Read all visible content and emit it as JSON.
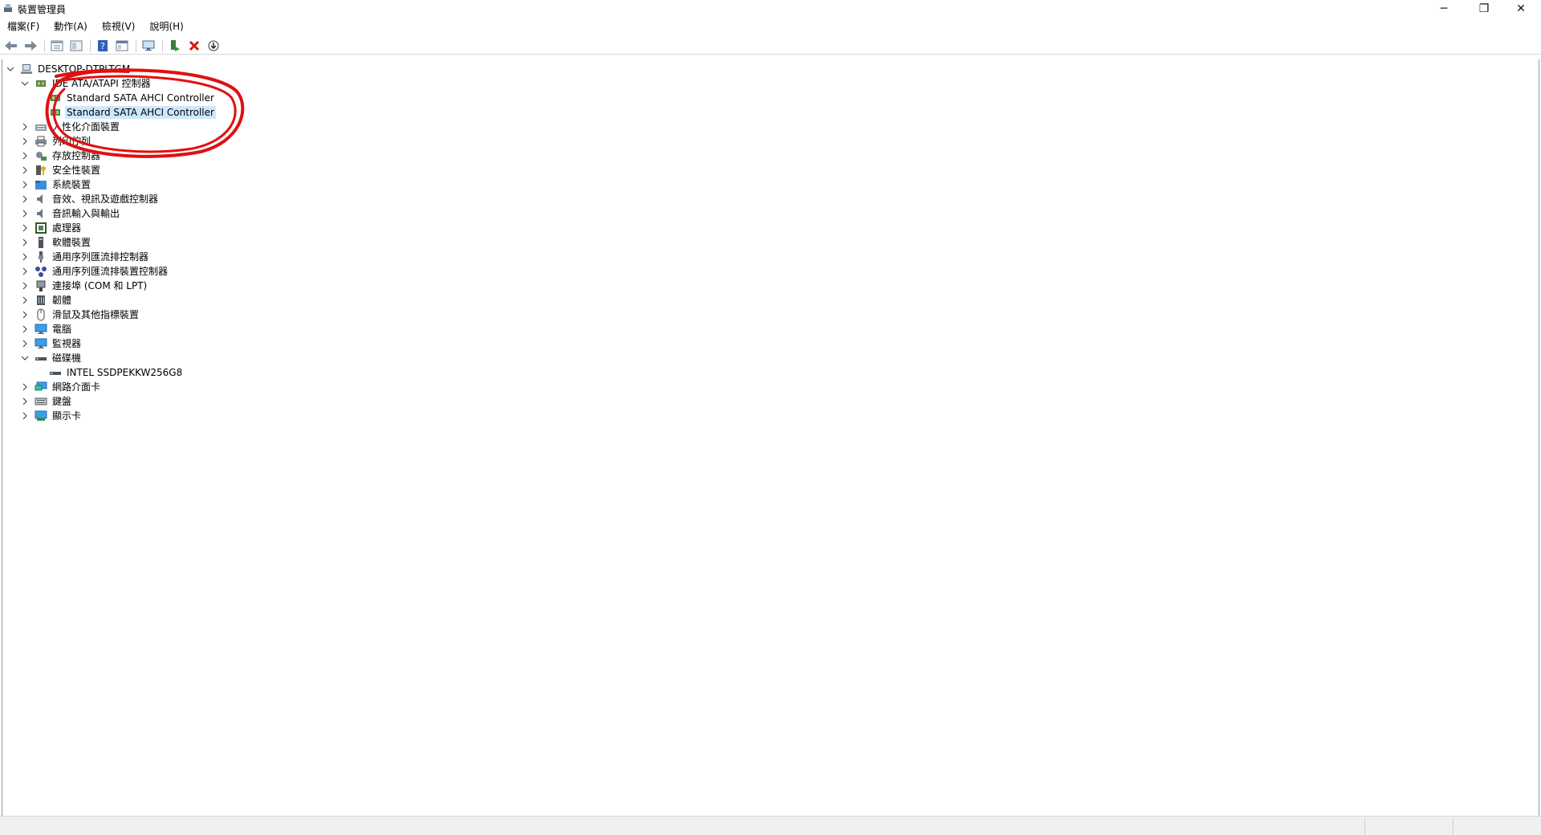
{
  "window": {
    "title": "裝置管理員"
  },
  "window_controls": {
    "minimize": "─",
    "restore": "❐",
    "close": "✕"
  },
  "menu": [
    "檔案(F)",
    "動作(A)",
    "檢視(V)",
    "說明(H)"
  ],
  "toolbar": {
    "icons": [
      "back-icon",
      "forward-icon",
      "properties-view-icon",
      "show-hide-tree-icon",
      "help-icon",
      "properties-icon",
      "monitor-scan-icon",
      "enable-device-icon",
      "uninstall-icon",
      "update-driver-icon"
    ]
  },
  "tree": {
    "root": "DESKTOP-DTPLTGM",
    "ide_category": "IDE ATA/ATAPI 控制器",
    "ide_children": [
      "Standard SATA AHCI Controller",
      "Standard SATA AHCI Controller"
    ],
    "categories_a": [
      "人性化介面裝置",
      "列印佇列",
      "存放控制器",
      "安全性裝置",
      "系統裝置",
      "音效、視訊及遊戲控制器",
      "音訊輸入與輸出",
      "處理器",
      "軟體裝置",
      "通用序列匯流排控制器",
      "通用序列匯流排裝置控制器",
      "連接埠 (COM 和 LPT)",
      "韌體",
      "滑鼠及其他指標裝置",
      "電腦",
      "監視器"
    ],
    "disk_category": "磁碟機",
    "disk_children": [
      "INTEL SSDPEKKW256G8"
    ],
    "categories_b": [
      "網路介面卡",
      "鍵盤",
      "顯示卡"
    ]
  },
  "colors": {
    "selection": "#cce8ff",
    "annotation": "#e01010",
    "uninstall": "#d01818"
  }
}
